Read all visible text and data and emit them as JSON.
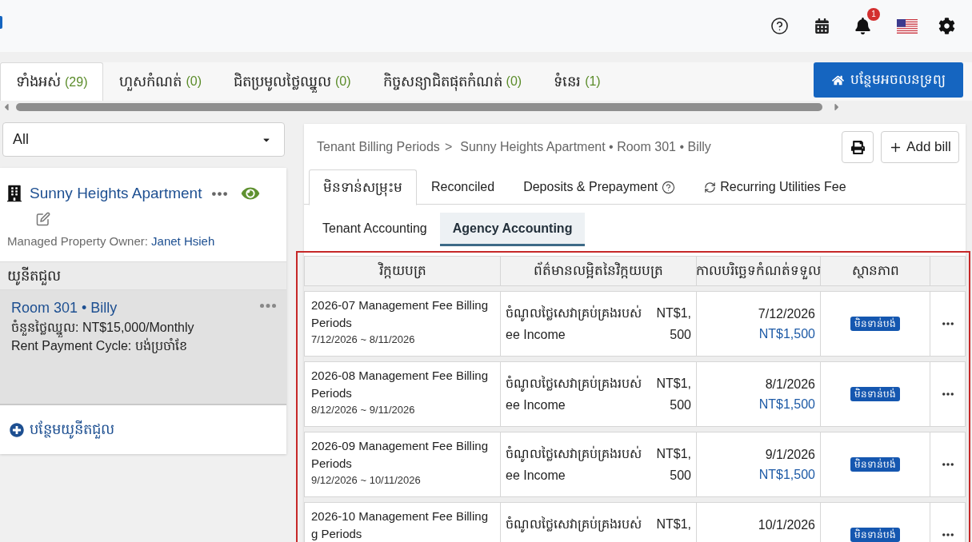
{
  "top_bar": {
    "notification_count": "1"
  },
  "property_tabs": [
    {
      "label": "ទាំងអស់",
      "count": "(29)",
      "selected": true
    },
    {
      "label": "ហួសកំណត់",
      "count": "(0)",
      "selected": false
    },
    {
      "label": "ជិតប្រមូលថ្លៃឈ្នួល",
      "count": "(0)",
      "selected": false
    },
    {
      "label": "កិច្ចសន្យាជិតផុតកំណត់",
      "count": "(0)",
      "selected": false
    },
    {
      "label": "ទំនេរ",
      "count": "(1)",
      "selected": false
    }
  ],
  "add_property_button": "បន្ថែមអចលនទ្រព្យ",
  "sidebar": {
    "filter": "All",
    "property": {
      "name": "Sunny Heights Apartment",
      "owner_label": "Managed Property Owner:",
      "owner_name": "Janet Hsieh"
    },
    "units_header": "យូនីតជួល",
    "units": [
      {
        "title": "Room 301 • Billy",
        "rent": "ចំនួនថ្លៃឈ្នួល: NT$15,000/Monthly",
        "cycle": "Rent Payment Cycle: បង់ប្រចាំខែ",
        "selected": true
      }
    ],
    "add_unit": "បន្ថែមយូនីតជួល"
  },
  "main": {
    "breadcrumb": {
      "parent": "Tenant Billing Periods",
      "separator": ">",
      "current": "Sunny Heights Apartment • Room 301 • Billy"
    },
    "add_bill_button": "Add bill",
    "tabs": [
      {
        "label": "មិនទាន់សម្រុះម",
        "kind": "plain",
        "selected": true
      },
      {
        "label": "Reconciled",
        "kind": "plain",
        "selected": false
      },
      {
        "label": "Deposits & Prepayment",
        "kind": "help",
        "selected": false
      },
      {
        "label": "Recurring Utilities Fee",
        "kind": "recurring",
        "selected": false
      }
    ],
    "subtabs": [
      {
        "label": "Tenant Accounting",
        "selected": false
      },
      {
        "label": "Agency Accounting",
        "selected": true
      }
    ],
    "table": {
      "columns": [
        "វិក្កយបត្រ",
        "ព័ត៌មានលម្អិតនៃវិក្កយបត្រ",
        "កាលបរិច្ឆេទកំណត់ទទួល",
        "ស្ថានភាព"
      ],
      "rows": [
        {
          "title": "2026-07 Management Fee Billing Periods",
          "period": "7/12/2026 ~ 8/11/2026",
          "detail": "ចំណូលថ្លៃសេវាគ្រប់គ្រងរបស់ ee Income",
          "amount": "NT$1,500",
          "due_date": "7/12/2026",
          "due_amount": "NT$1,500",
          "status": "មិនទាន់បង់"
        },
        {
          "title": "2026-08 Management Fee Billing Periods",
          "period": "8/12/2026 ~ 9/11/2026",
          "detail": "ចំណូលថ្លៃសេវាគ្រប់គ្រងរបស់ ee Income",
          "amount": "NT$1,500",
          "due_date": "8/1/2026",
          "due_amount": "NT$1,500",
          "status": "មិនទាន់បង់"
        },
        {
          "title": "2026-09 Management Fee Billing Periods",
          "period": "9/12/2026 ~ 10/11/2026",
          "detail": "ចំណូលថ្លៃសេវាគ្រប់គ្រងរបស់ ee Income",
          "amount": "NT$1,500",
          "due_date": "9/1/2026",
          "due_amount": "NT$1,500",
          "status": "មិនទាន់បង់"
        },
        {
          "title": "2026-10 Management Fee Billing g Periods",
          "detail": "ចំណូលថ្លៃសេវាគ្រប់គ្រងរបស់",
          "amount": "NT$1,",
          "due_date": "10/1/2026",
          "status": "មិនទាន់បង់"
        }
      ]
    }
  }
}
